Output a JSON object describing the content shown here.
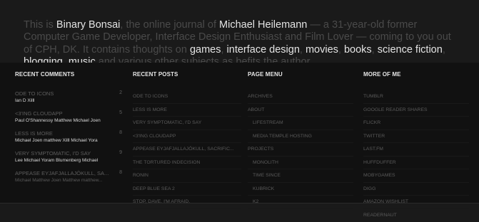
{
  "intro": {
    "t1": "This is ",
    "site": "Binary Bonsai",
    "t2": ", the online journal of ",
    "author": "Michael Heilemann",
    "t3": " — a 31-year-old former Computer Game Developer, Interface Design Enthusiast and Film Lover — coming to you out of CPH, DK. It contains thoughts on ",
    "topic1": "games",
    "s1": ", ",
    "topic2": "interface design",
    "s2": ", ",
    "topic3": "movies",
    "s3": ", ",
    "topic4": "books",
    "s4": ", ",
    "topic5": "science fiction",
    "s5": ", ",
    "topic6": "blogging",
    "s6": ", ",
    "topic7": "music",
    "t4": " and various other subjects as befits the author."
  },
  "recent_comments": {
    "heading": "RECENT COMMENTS",
    "items": [
      {
        "title": "ODE TO ICONS",
        "count": "2",
        "commenters": "Ian D  Xilll"
      },
      {
        "title": "<3'ING CLOUDAPP",
        "count": "5",
        "commenters": "Paul O'Shannessy  Matthew  Michael  Joen"
      },
      {
        "title": "LESS IS MORE",
        "count": "8",
        "commenters": "Michael  Joen  matthew  Xilll  Michael  Yora"
      },
      {
        "title": "VERY SYMPTOMATIC, I'D SAY",
        "count": "9",
        "commenters": "Lee  Michael  Yoram Blumenberg  Michael"
      },
      {
        "title": "APPEASE EYJAFJALLAJÖKULL, SA...",
        "count": "8",
        "commenters": "Michael  Matthew  Joen  Matthew  matthew..."
      }
    ]
  },
  "recent_posts": {
    "heading": "RECENT POSTS",
    "items": [
      "ODE TO ICONS",
      "LESS IS MORE",
      "VERY SYMPTOMATIC, I'D SAY",
      "<3'ING CLOUDAPP",
      "APPEASE EYJAFJALLAJÖKULL, SACRIFIC...",
      "THE TORTURED INDECISION",
      "RONIN",
      "DEEP BLUE SEA 2",
      "STOP, DAVE. I'M AFRAID."
    ]
  },
  "page_menu": {
    "heading": "PAGE MENU",
    "items": [
      {
        "label": "ARCHIVES",
        "sub": false
      },
      {
        "label": "ABOUT",
        "sub": false
      },
      {
        "label": "LIFESTREAM",
        "sub": true
      },
      {
        "label": "MEDIA TEMPLE HOSTING",
        "sub": true
      },
      {
        "label": "PROJECTS",
        "sub": false
      },
      {
        "label": "MONOLITH",
        "sub": true
      },
      {
        "label": "TIME SINCE",
        "sub": true
      },
      {
        "label": "KUBRICK",
        "sub": true
      },
      {
        "label": "K2",
        "sub": true
      }
    ]
  },
  "more_of_me": {
    "heading": "MORE OF ME",
    "items": [
      "TUMBLR",
      "GOOGLE READER SHARES",
      "FLICKR",
      "TWITTER",
      "LAST.FM",
      "HUFFDUFFER",
      "MOBYGAMES",
      "DIGG",
      "AMAZON WISHLIST",
      "READERNAUT"
    ]
  }
}
